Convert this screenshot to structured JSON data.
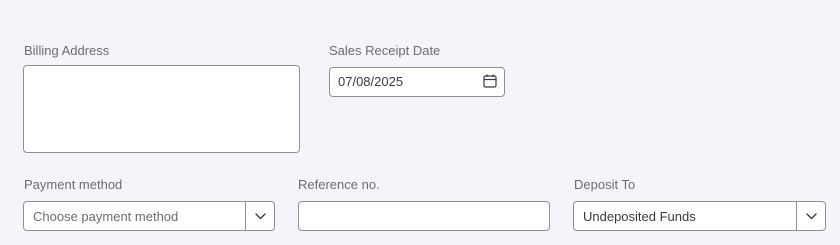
{
  "billing": {
    "label": "Billing Address",
    "value": ""
  },
  "sales_receipt_date": {
    "label": "Sales Receipt Date",
    "value": "07/08/2025"
  },
  "payment_method": {
    "label": "Payment method",
    "placeholder": "Choose payment method"
  },
  "reference_no": {
    "label": "Reference no.",
    "value": ""
  },
  "deposit_to": {
    "label": "Deposit To",
    "value": "Undeposited Funds"
  },
  "icons": {
    "date_picker": "calendar-icon",
    "dropdown": "chevron-down-icon"
  }
}
